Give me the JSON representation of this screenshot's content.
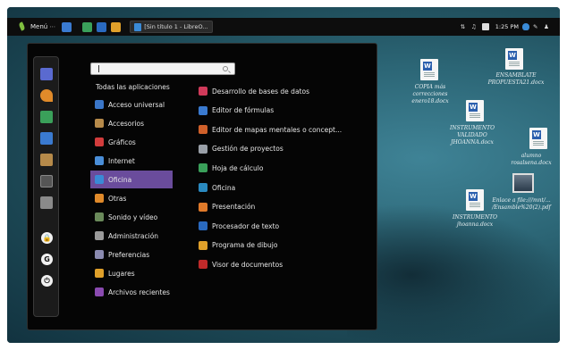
{
  "panel": {
    "menu_label": "Menú",
    "task_title": "[Sin título 1 - LibreO...",
    "clock": "1:25 PM"
  },
  "search": {
    "placeholder": ""
  },
  "menu": {
    "all_apps": "Todas las aplicaciones",
    "categories": [
      {
        "label": "Acceso universal",
        "color": "#3a76c8",
        "selected": false
      },
      {
        "label": "Accesorios",
        "color": "#b68a4a",
        "selected": false
      },
      {
        "label": "Gráficos",
        "color": "#d23c3c",
        "selected": false
      },
      {
        "label": "Internet",
        "color": "#4a8ed8",
        "selected": false
      },
      {
        "label": "Oficina",
        "color": "#3a8ad6",
        "selected": true
      },
      {
        "label": "Otras",
        "color": "#e08a2a",
        "selected": false
      },
      {
        "label": "Sonido y vídeo",
        "color": "#6a8a5a",
        "selected": false
      },
      {
        "label": "Administración",
        "color": "#9a9a9a",
        "selected": false
      },
      {
        "label": "Preferencias",
        "color": "#8a8ab0",
        "selected": false
      },
      {
        "label": "Lugares",
        "color": "#e0a02a",
        "selected": false
      },
      {
        "label": "Archivos recientes",
        "color": "#8a4ab0",
        "selected": false
      }
    ],
    "apps": [
      {
        "label": "Desarrollo de bases de datos",
        "color": "#d03a5a"
      },
      {
        "label": "Editor de fórmulas",
        "color": "#3a7ad0"
      },
      {
        "label": "Editor de mapas mentales o concept...",
        "color": "#d0602a"
      },
      {
        "label": "Gestión de proyectos",
        "color": "#9aa0a8"
      },
      {
        "label": "Hoja de cálculo",
        "color": "#3aa05a"
      },
      {
        "label": "Oficina",
        "color": "#2a8ac0"
      },
      {
        "label": "Presentación",
        "color": "#e07a2a"
      },
      {
        "label": "Procesador de texto",
        "color": "#2a6ac0"
      },
      {
        "label": "Programa de dibujo",
        "color": "#e0a02a"
      },
      {
        "label": "Visor de documentos",
        "color": "#c02a2a"
      }
    ]
  },
  "desktop": {
    "icons": [
      {
        "label": "COPIA más correcciones enero18.docx"
      },
      {
        "label": "ENSAMBLATE PROPUESTA21.docx"
      },
      {
        "label": "INSTRUMENTO VALIDADO JHOANNA.docx"
      },
      {
        "label": "alumno rosalsena.docx"
      },
      {
        "label": "Enlace a file:///mnt/... /Ensamble%20(2).pdf"
      },
      {
        "label": "INSTRUMENTO jhoanna.docx"
      }
    ]
  },
  "colors": {
    "selected_bg": "#6a4c9c",
    "panel_bg": "#0d0d0d"
  }
}
